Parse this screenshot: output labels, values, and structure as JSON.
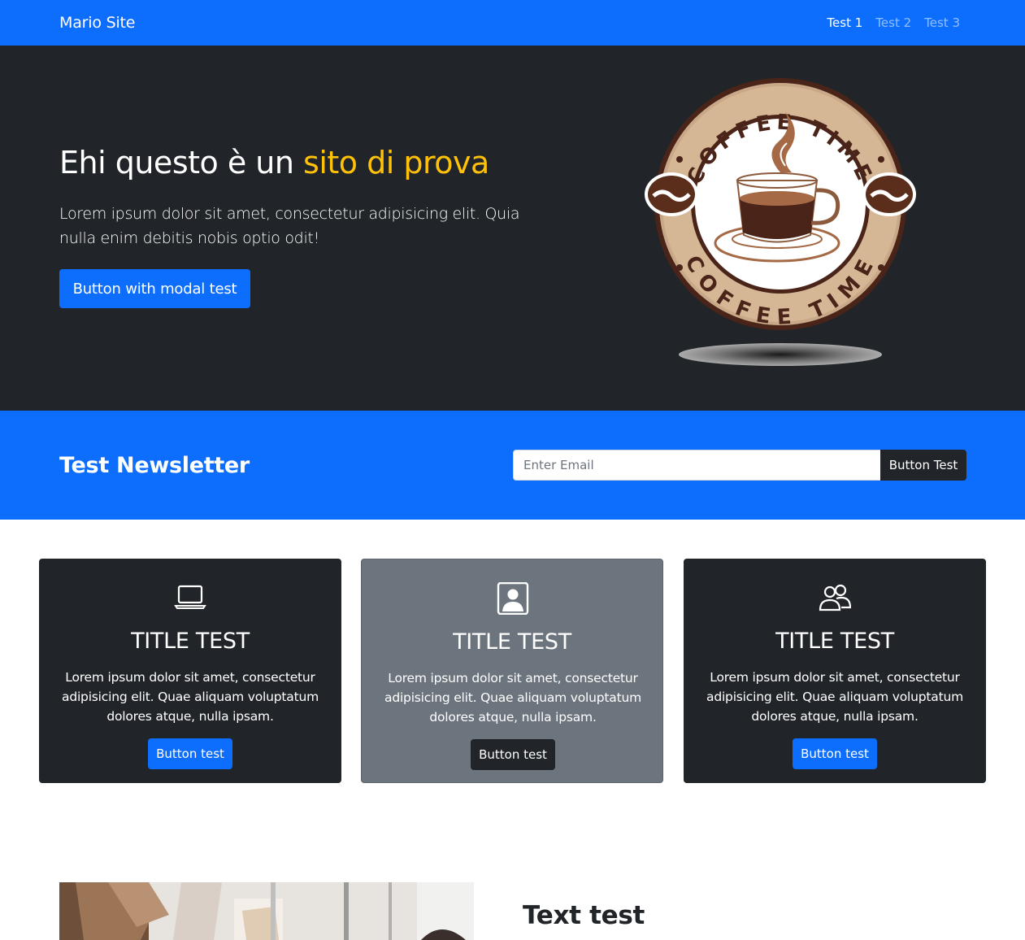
{
  "navbar": {
    "brand": "Mario Site",
    "links": [
      {
        "label": "Test 1",
        "active": true
      },
      {
        "label": "Test 2",
        "active": false
      },
      {
        "label": "Test 3",
        "active": false
      }
    ]
  },
  "hero": {
    "title_plain": "Ehi questo è un ",
    "title_accent": "sito di prova",
    "lead": "Lorem ipsum dolor sit amet, consectetur adipisicing elit. Quia nulla enim debitis nobis optio odit!",
    "button_label": "Button with modal test",
    "logo_text_top": "COFFEE TIME",
    "logo_text_bottom": "COFFEE TIME"
  },
  "newsletter": {
    "title": "Test Newsletter",
    "email_placeholder": "Enter Email",
    "email_value": "",
    "button_label": "Button Test"
  },
  "cards": [
    {
      "icon": "laptop-icon",
      "title": "TITLE TEST",
      "text": "Lorem ipsum dolor sit amet, consectetur adipisicing elit. Quae aliquam voluptatum dolores atque, nulla ipsam.",
      "button_label": "Button test"
    },
    {
      "icon": "person-square-icon",
      "title": "TITLE TEST",
      "text": "Lorem ipsum dolor sit amet, consectetur adipisicing elit. Quae aliquam voluptatum dolores atque, nulla ipsam.",
      "button_label": "Button test"
    },
    {
      "icon": "people-icon",
      "title": "TITLE TEST",
      "text": "Lorem ipsum dolor sit amet, consectetur adipisicing elit. Quae aliquam voluptatum dolores atque, nulla ipsam.",
      "button_label": "Button test"
    }
  ],
  "section2": {
    "title": "Text test"
  },
  "colors": {
    "primary": "#0d6efd",
    "dark": "#212529",
    "secondary": "#6c757d",
    "warning": "#ffc107"
  }
}
